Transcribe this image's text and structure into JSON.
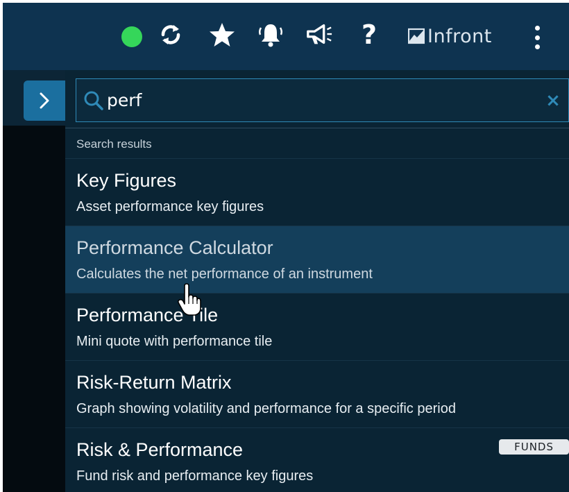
{
  "topbar": {
    "icons": [
      "status-online-icon",
      "refresh-icon",
      "star-icon",
      "bell-icon",
      "megaphone-icon",
      "help-icon"
    ],
    "help_glyph": "?",
    "brand_label": "Infront",
    "status_color": "#35d65a"
  },
  "sidebar": {
    "toggle_icon": "chevron-right-icon"
  },
  "search": {
    "value": "perf",
    "clear_glyph": "×",
    "accent_color": "#2f8ab8"
  },
  "results": {
    "heading": "Search results",
    "items": [
      {
        "title": "Key Figures",
        "description": "Asset performance key figures"
      },
      {
        "title": "Performance Calculator",
        "description": "Calculates the net performance of an instrument"
      },
      {
        "title": "Performance Tile",
        "description": "Mini quote with performance tile"
      },
      {
        "title": "Risk-Return Matrix",
        "description": "Graph showing volatility and performance for a specific period"
      },
      {
        "title": "Risk & Performance",
        "description": "Fund risk and performance key figures",
        "badge": "FUNDS"
      }
    ]
  }
}
